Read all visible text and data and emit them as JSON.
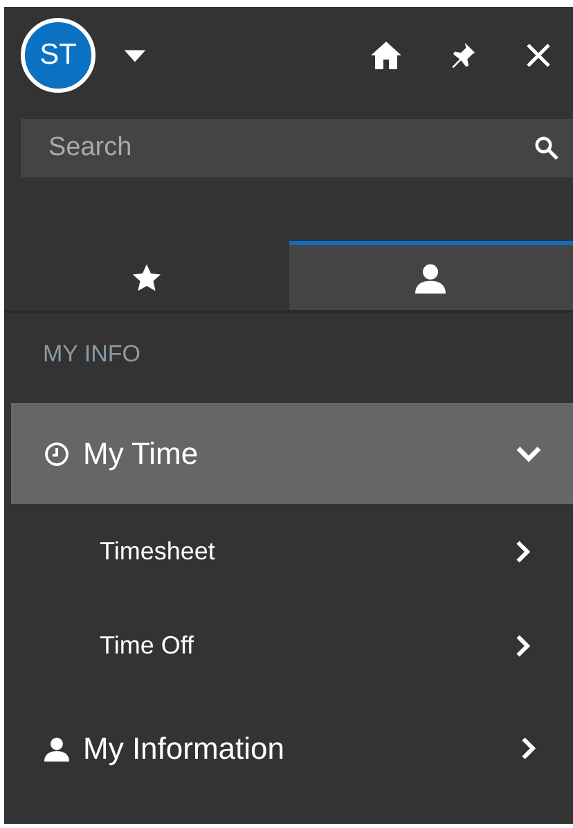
{
  "header": {
    "avatar": "ST"
  },
  "search": {
    "placeholder": "Search"
  },
  "tabs": [
    {
      "kind": "star",
      "selected": false
    },
    {
      "kind": "person",
      "selected": true
    }
  ],
  "section": "MY INFO",
  "menu": [
    {
      "label": "My Time",
      "kind": "clock",
      "selected": true,
      "expanded": true,
      "children": [
        {
          "label": "Timesheet"
        },
        {
          "label": "Time Off"
        }
      ]
    },
    {
      "label": "My Information",
      "kind": "person",
      "selected": false,
      "expanded": false
    }
  ]
}
